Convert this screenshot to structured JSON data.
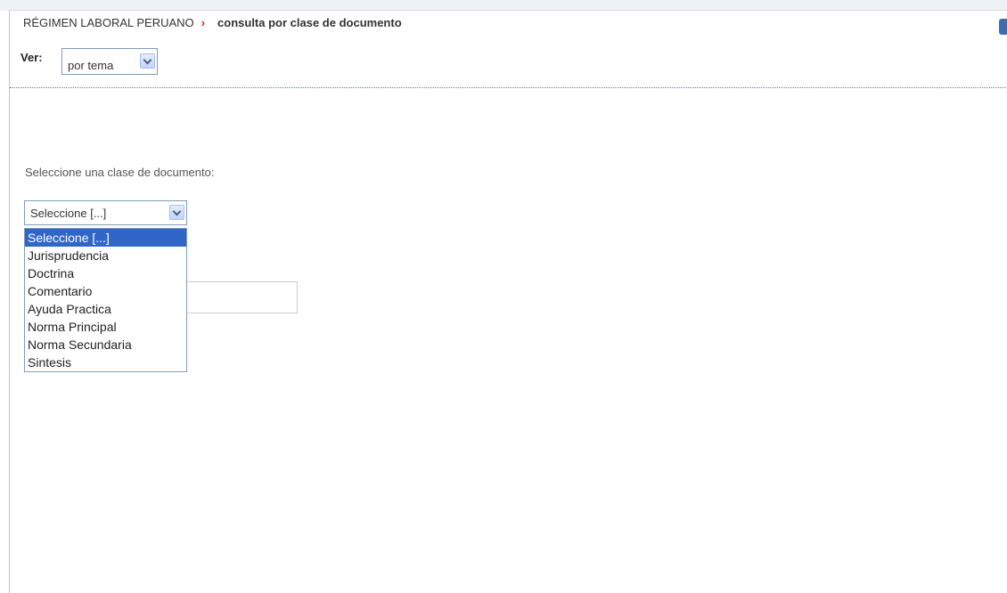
{
  "breadcrumb": {
    "root": "RÉGIMEN LABORAL PERUANO",
    "separator": "›",
    "current": "consulta por clase de documento"
  },
  "view": {
    "label": "Ver:",
    "selected": "por tema"
  },
  "document_class": {
    "prompt": "Seleccione una clase de documento:",
    "selected": "Seleccione [...]",
    "options": [
      "Seleccione [...]",
      "Jurisprudencia",
      "Doctrina",
      "Comentario",
      "Ayuda Practica",
      "Norma Principal",
      "Norma Secundaria",
      "Sintesis"
    ],
    "highlighted_index": 0
  },
  "colors": {
    "accent": "#c0272d",
    "highlight": "#3166c9",
    "separator": "#4f7fb5"
  },
  "icons": [
    "close-icon",
    "chevron-right-icon",
    "chevron-down-icon"
  ]
}
